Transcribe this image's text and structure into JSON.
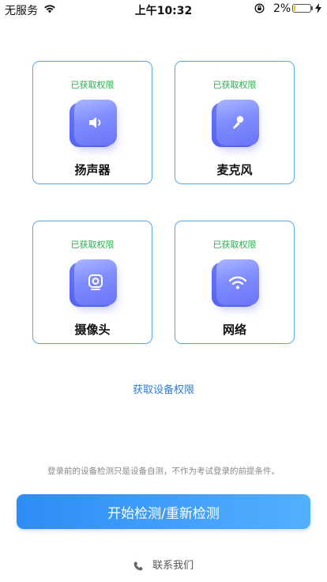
{
  "status_bar": {
    "carrier": "无服务",
    "time": "上午10:32",
    "battery_percent": "2%",
    "battery_level": 0.02
  },
  "cards": [
    {
      "status": "已获取权限",
      "label": "扬声器",
      "icon": "speaker-icon"
    },
    {
      "status": "已获取权限",
      "label": "麦克风",
      "icon": "microphone-icon"
    },
    {
      "status": "已获取权限",
      "label": "摄像头",
      "icon": "camera-icon"
    },
    {
      "status": "已获取权限",
      "label": "网络",
      "icon": "wifi-icon"
    }
  ],
  "get_permission_link": "获取设备权限",
  "notice": "登录前的设备检测只是设备自测，不作为考试登录的前提条件。",
  "start_button": "开始检测/重新检测",
  "contact": "联系我们",
  "colors": {
    "accent": "#2d7de0",
    "granted": "#23b24b",
    "card_border": "#5aa6ea",
    "icon": "#7f8cff"
  }
}
